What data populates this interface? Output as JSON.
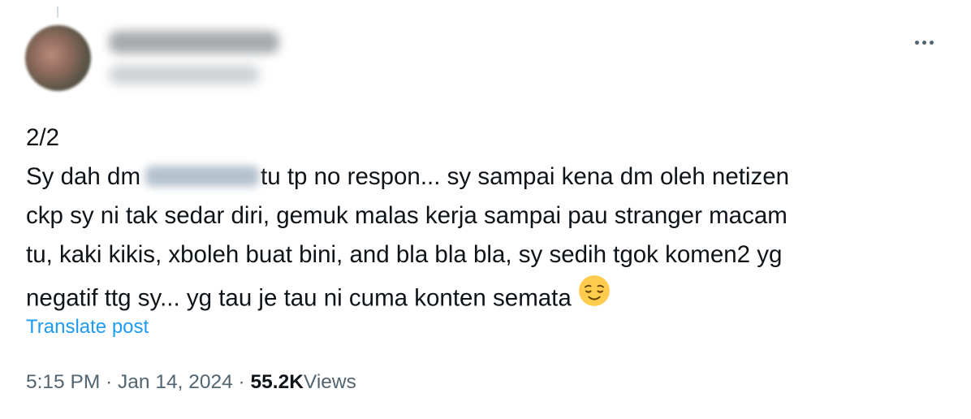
{
  "tweet": {
    "text_lines": [
      "2/2",
      "Sy dah dm",
      "tu tp no respon... sy sampai kena dm oleh netizen",
      "ckp sy ni tak sedar diri, gemuk malas kerja sampai pau stranger macam",
      "tu, kaki kikis, xboleh buat bini, and bla bla bla, sy sedih tgok komen2 yg",
      "negatif ttg sy... yg tau je tau ni cuma konten semata"
    ],
    "emoji": "relieved-face",
    "translate_label": "Translate post",
    "time": "5:15 PM",
    "separator": "·",
    "date": "Jan 14, 2024",
    "views_count": "55.2K",
    "views_label": "Views"
  },
  "colors": {
    "text": "#0f1419",
    "secondary": "#536471",
    "link": "#1d9bf0"
  }
}
